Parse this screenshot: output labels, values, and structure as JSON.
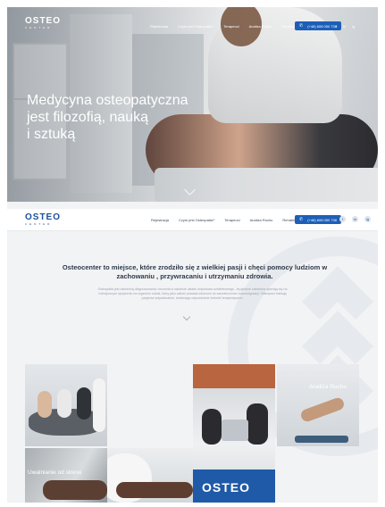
{
  "brand": {
    "name": "OSTEO",
    "tagline": "CENTER"
  },
  "nav": {
    "items": [
      "Rejestracja",
      "Czym jest Osteopatia?",
      "Terapeuci",
      "Analiza Ruchu",
      "Rehabilitacja"
    ],
    "phone": "(+48) 608 050 738",
    "social": [
      "f",
      "in",
      "ig"
    ]
  },
  "hero": {
    "title_lines": [
      "Medycyna osteopatyczna",
      "jest filozofią, nauką",
      "i sztuką"
    ]
  },
  "intro": {
    "heading": "Osteocenter to miejsce, które zrodziło się z wielkiej pasji i chęci pomocy ludziom w zachowaniu , przywracaniu i utrzymaniu zdrowia.",
    "body": "Osteopatia jest dziedziną diagnozowania i leczenia w zakresie układu mięśniowo-szkieletowego. Jej główne założenia opierają się na holistycznym spojrzeniu na organizm ludzki, który jako całość posiada zdolność do samoleczenia i samoregulacji. Osteopaci traktują pacjenta indywidualnie, dobierając odpowiednie techniki terapeutyczne."
  },
  "gallery": {
    "labels": {
      "stress": "Uwalnianie od stresu",
      "movement": "Analiza Ruchu"
    },
    "reception_sign": "OSTEO"
  },
  "colors": {
    "accent": "#1d5fb8",
    "heading": "#2d3a4a",
    "muted": "#9aa4ae"
  }
}
